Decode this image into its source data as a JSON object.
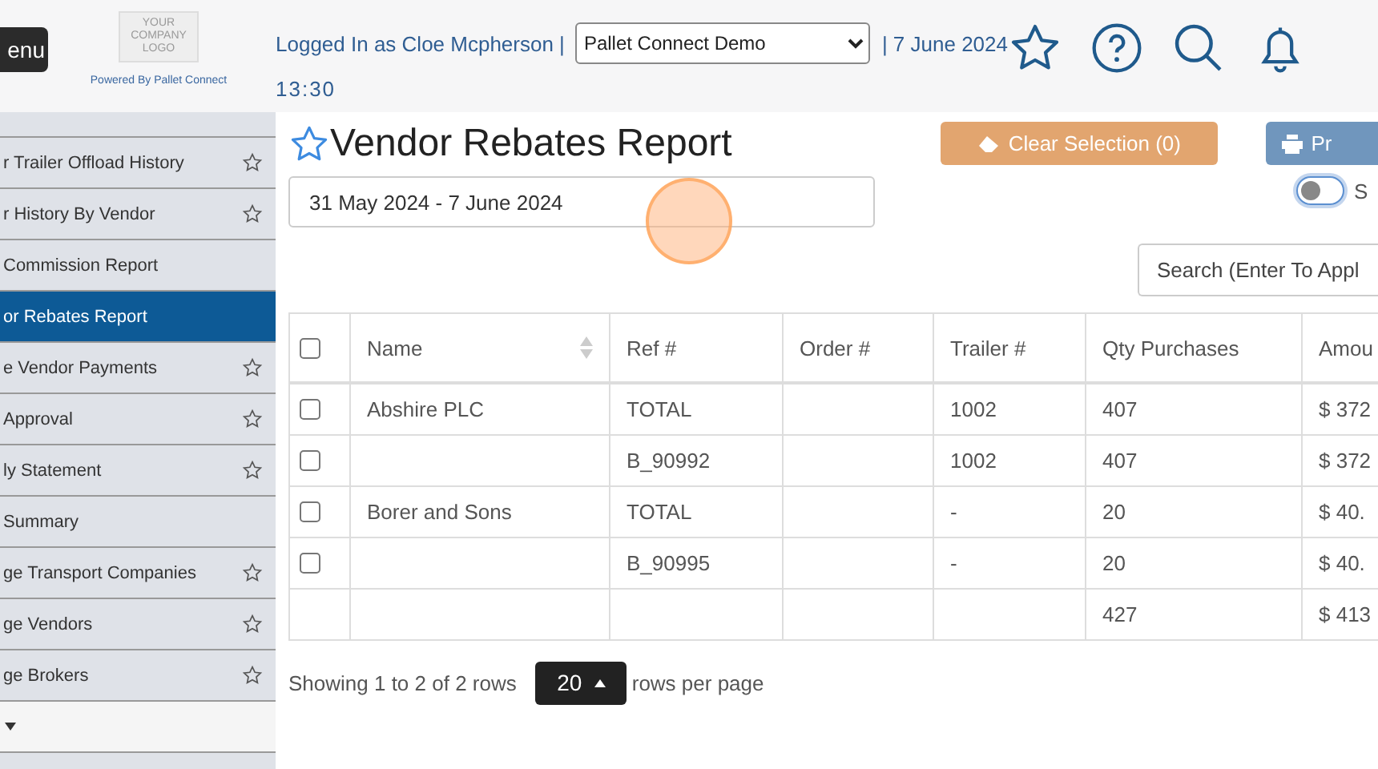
{
  "header": {
    "menu_button": "enu",
    "logo": [
      "YOUR",
      "COMPANY",
      "LOGO"
    ],
    "powered_by": "Powered By Pallet Connect",
    "logged_in": "Logged In as Cloe Mcpherson |",
    "company_select": "Pallet Connect Demo",
    "date": "| 7 June 2024",
    "time": "13:30"
  },
  "sidebar": {
    "items": [
      {
        "label": "r Trailer Offload History",
        "starred": true,
        "selected": false
      },
      {
        "label": "r History By Vendor",
        "starred": true,
        "selected": false
      },
      {
        "label": "Commission Report",
        "starred": false,
        "selected": false
      },
      {
        "label": "or Rebates Report",
        "starred": false,
        "selected": true
      },
      {
        "label": "e Vendor Payments",
        "starred": true,
        "selected": false
      },
      {
        "label": "Approval",
        "starred": true,
        "selected": false
      },
      {
        "label": "ly Statement",
        "starred": true,
        "selected": false
      },
      {
        "label": "Summary",
        "starred": false,
        "selected": false
      },
      {
        "label": "ge Transport Companies",
        "starred": true,
        "selected": false
      },
      {
        "label": "ge Vendors",
        "starred": true,
        "selected": false
      },
      {
        "label": "ge Brokers",
        "starred": true,
        "selected": false
      }
    ]
  },
  "page": {
    "title": "Vendor Rebates Report",
    "favorite": false,
    "clear_button": "Clear Selection (0)",
    "print_button": "Pr",
    "date_range": "31 May 2024 - 7 June 2024",
    "toggle": {
      "on": false,
      "label": "S"
    },
    "search": {
      "placeholder": "Search (Enter To Appl"
    }
  },
  "table": {
    "select_all": {
      "checked": false
    },
    "columns": [
      {
        "label": "Name",
        "sortable": true
      },
      {
        "label": "Ref #",
        "sortable": false
      },
      {
        "label": "Order #",
        "sortable": false
      },
      {
        "label": "Trailer #",
        "sortable": false
      },
      {
        "label": "Qty Purchases",
        "sortable": false
      },
      {
        "label": "Amou",
        "sortable": false
      }
    ],
    "rows": [
      {
        "kind": "item",
        "checked": false,
        "cells": [
          "Abshire PLC",
          "TOTAL",
          "",
          "1002",
          "407",
          "$ 372"
        ]
      },
      {
        "kind": "item",
        "checked": false,
        "cells": [
          "",
          "B_90992",
          "",
          "1002",
          "407",
          "$ 372"
        ]
      },
      {
        "kind": "item",
        "checked": false,
        "cells": [
          "Borer and Sons",
          "TOTAL",
          "",
          "-",
          "20",
          "$ 40."
        ]
      },
      {
        "kind": "item",
        "checked": false,
        "cells": [
          "",
          "B_90995",
          "",
          "-",
          "20",
          "$ 40."
        ]
      },
      {
        "kind": "total",
        "cells": [
          "",
          "",
          "",
          "",
          "427",
          "$ 413"
        ]
      }
    ]
  },
  "footer": {
    "showing": "Showing 1 to 2 of 2 rows",
    "page_size": "20",
    "per_page": "rows per page"
  }
}
